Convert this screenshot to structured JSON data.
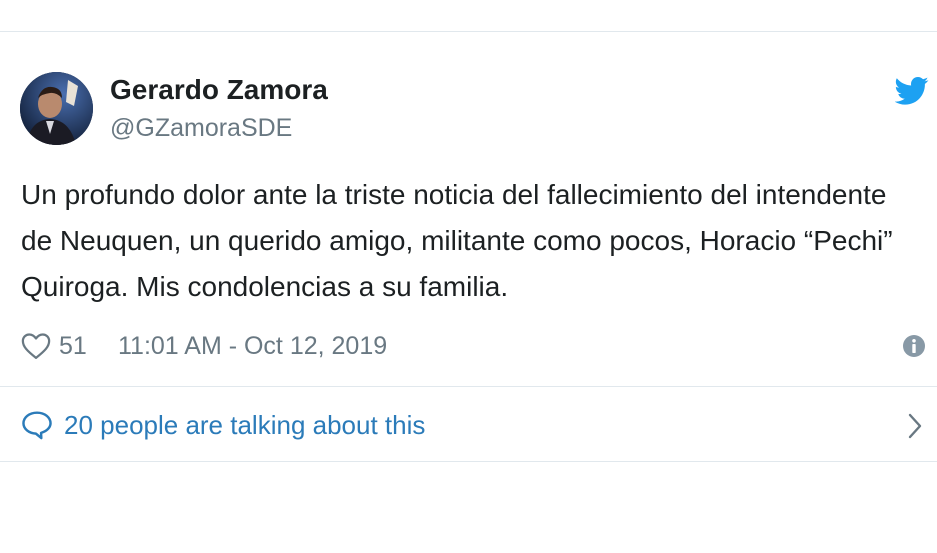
{
  "tweet": {
    "author_name": "Gerardo Zamora",
    "author_handle": "@GZamoraSDE",
    "text": "Un profundo dolor ante la triste noticia del fallecimiento del intendente de Neuquen, un querido amigo, militante como pocos, Horacio “Pechi” Quiroga. Mis condolencias a su familia.",
    "like_count": "51",
    "timestamp": "11:01 AM - Oct 12, 2019",
    "talking_label": "20 people are talking about this"
  },
  "icons": {
    "brand": "twitter-bird-icon",
    "like": "heart-icon",
    "info": "info-icon",
    "conversation": "speech-bubble-icon",
    "chevron": "chevron-right-icon"
  },
  "colors": {
    "twitter_blue": "#1da1f2",
    "link_blue": "#2b7bb9",
    "muted_gray": "#697882",
    "text": "#1c2022",
    "border": "#e1e8ed"
  }
}
